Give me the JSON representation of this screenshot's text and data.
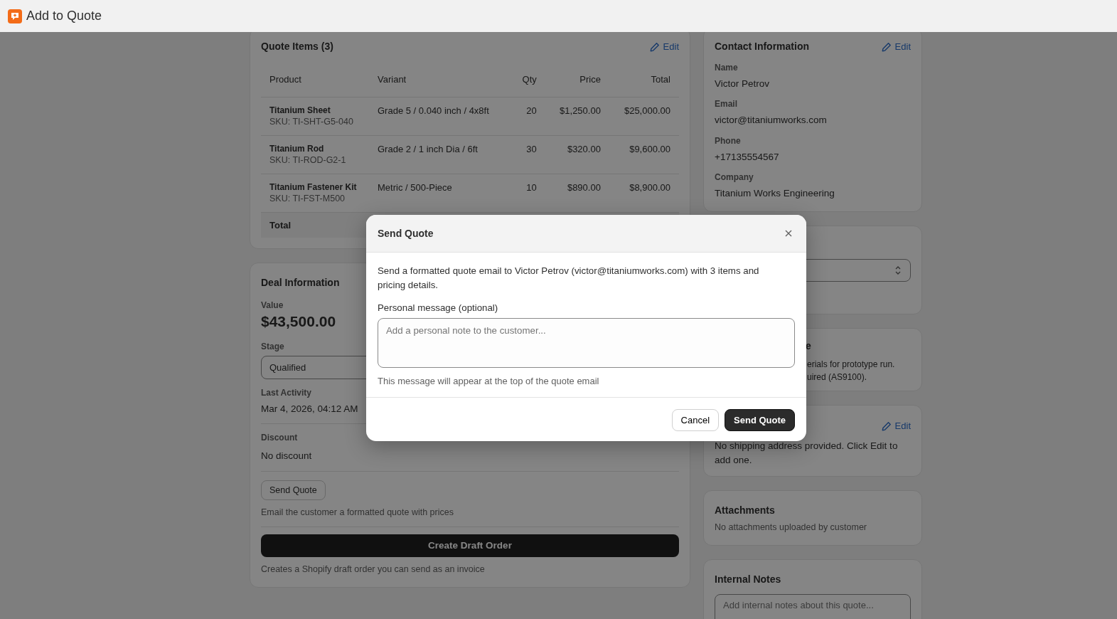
{
  "app_bar": {
    "title": "Add to Quote"
  },
  "quote_items": {
    "title": "Quote Items (3)",
    "edit_label": "Edit",
    "columns": [
      "Product",
      "Variant",
      "Qty",
      "Price",
      "Total"
    ],
    "rows": [
      {
        "product": "Titanium Sheet",
        "sku": "SKU: TI-SHT-G5-040",
        "variant": "Grade 5 / 0.040 inch / 4x8ft",
        "qty": "20",
        "price": "$1,250.00",
        "total": "$25,000.00"
      },
      {
        "product": "Titanium Rod",
        "sku": "SKU: TI-ROD-G2-1",
        "variant": "Grade 2 / 1 inch Dia / 6ft",
        "qty": "30",
        "price": "$320.00",
        "total": "$9,600.00"
      },
      {
        "product": "Titanium Fastener Kit",
        "sku": "SKU: TI-FST-M500",
        "variant": "Metric / 500-Piece",
        "qty": "10",
        "price": "$890.00",
        "total": "$8,900.00"
      }
    ],
    "total_label": "Total"
  },
  "deal": {
    "title": "Deal Information",
    "value_label": "Value",
    "value": "$43,500.00",
    "stage_label": "Stage",
    "stage": "Qualified",
    "last_activity_label": "Last Activity",
    "last_activity": "Mar 4, 2026, 04:12 AM",
    "discount_label": "Discount",
    "discount": "No discount",
    "send_button": "Send Quote",
    "send_hint": "Email the customer a formatted quote with prices",
    "create_button": "Create Draft Order",
    "create_hint": "Creates a Shopify draft order you can send as an invoice"
  },
  "contact": {
    "title": "Contact Information",
    "edit_label": "Edit",
    "fields": [
      {
        "label": "Name",
        "value": "Victor Petrov"
      },
      {
        "label": "Email",
        "value": "victor@titaniumworks.com"
      },
      {
        "label": "Phone",
        "value": "+17135554567"
      },
      {
        "label": "Company",
        "value": "Titanium Works Engineering"
      }
    ]
  },
  "notes_card": {
    "title_fragment": "e",
    "lines": [
      "erials for prototype run.",
      "uired (AS9100)."
    ]
  },
  "shipping": {
    "edit_label": "Edit",
    "text": "No shipping address provided. Click Edit to add one."
  },
  "attachments": {
    "title": "Attachments",
    "text": "No attachments uploaded by customer"
  },
  "internal_notes": {
    "title": "Internal Notes",
    "placeholder": "Add internal notes about this quote..."
  },
  "modal": {
    "title": "Send Quote",
    "message": "Send a formatted quote email to Victor Petrov (victor@titaniumworks.com) with 3 items and pricing details.",
    "field_label": "Personal message (optional)",
    "placeholder": "Add a personal note to the customer...",
    "help": "This message will appear at the top of the quote email",
    "buttons": [
      {
        "label": "Cancel",
        "kind": "secondary"
      },
      {
        "label": "Send Quote",
        "kind": "primary"
      }
    ]
  }
}
